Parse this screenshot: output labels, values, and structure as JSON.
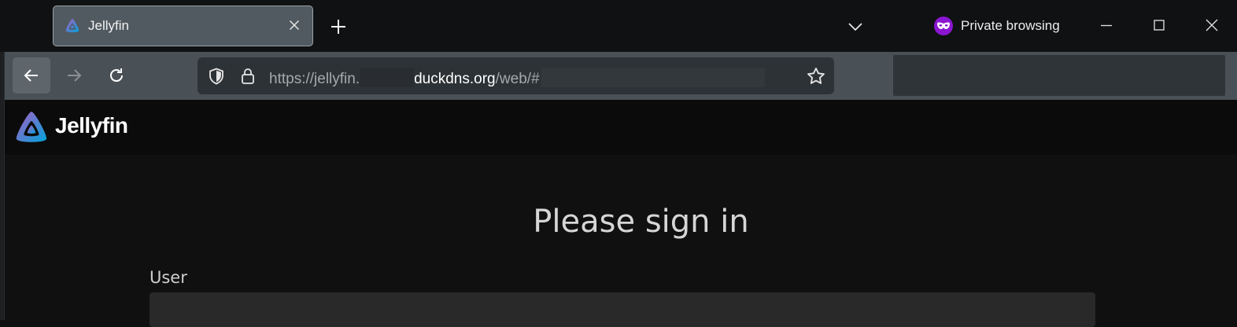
{
  "browser": {
    "tab": {
      "title": "Jellyfin",
      "favicon": "jellyfin-logo-icon"
    },
    "private_browsing": {
      "label": "Private browsing",
      "icon": "mask-icon",
      "color": "#8b16d1"
    },
    "toolbar": {
      "back_icon": "arrow-left-icon",
      "forward_icon": "arrow-right-icon",
      "reload_icon": "reload-icon"
    },
    "urlbar": {
      "scheme_prefix": "https://jellyfin.",
      "host": "duckdns.org",
      "path": "/web/#"
    }
  },
  "app": {
    "name": "Jellyfin",
    "brand_gradient": [
      "#aa5cc3",
      "#00a4dc"
    ]
  },
  "login": {
    "title": "Please sign in",
    "user_label": "User",
    "user_value": ""
  }
}
